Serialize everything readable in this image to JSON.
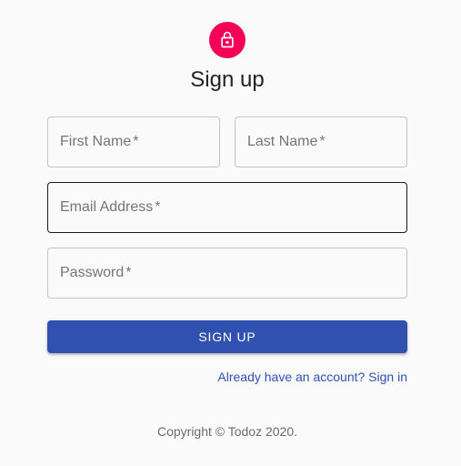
{
  "header": {
    "icon": "lock-icon",
    "title": "Sign up"
  },
  "form": {
    "first_name": {
      "label": "First Name",
      "required_mark": "*",
      "value": ""
    },
    "last_name": {
      "label": "Last Name",
      "required_mark": "*",
      "value": ""
    },
    "email": {
      "label": "Email Address",
      "required_mark": "*",
      "value": ""
    },
    "password": {
      "label": "Password",
      "required_mark": "*",
      "value": ""
    },
    "submit_label": "SIGN UP",
    "signin_link": "Already have an account? Sign in"
  },
  "footer": {
    "copyright": "Copyright © Todoz 2020."
  },
  "colors": {
    "avatar_bg": "#f50057",
    "primary": "#3051b0",
    "background": "#fafafa"
  }
}
